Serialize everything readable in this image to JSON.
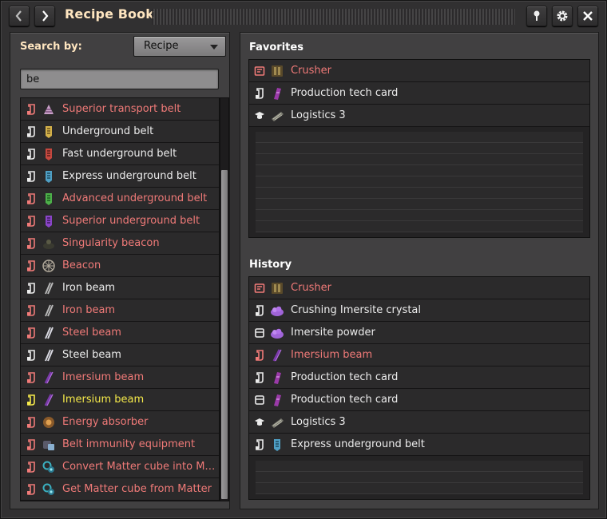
{
  "window": {
    "title": "Recipe Book"
  },
  "colors": {
    "title": "#ffe6c0",
    "red": "#f07a78",
    "white": "#ececec",
    "yellow": "#f5e94a",
    "panel": "#414041",
    "list_bg": "#242324"
  },
  "titlebar": {
    "back_icon": "chevron-left-icon",
    "forward_icon": "chevron-right-icon",
    "pin_icon": "pin-icon",
    "settings_icon": "gear-icon",
    "close_icon": "close-icon"
  },
  "search": {
    "label": "Search by:",
    "mode": "Recipe",
    "query": "be"
  },
  "results": [
    {
      "label": "Superior transport belt",
      "color": "red",
      "type": "recipe",
      "icon": "belt-superior"
    },
    {
      "label": "Underground belt",
      "color": "white",
      "type": "recipe",
      "icon": "underground-yellow"
    },
    {
      "label": "Fast underground belt",
      "color": "white",
      "type": "recipe",
      "icon": "underground-red"
    },
    {
      "label": "Express underground belt",
      "color": "white",
      "type": "recipe",
      "icon": "underground-blue"
    },
    {
      "label": "Advanced underground belt",
      "color": "red",
      "type": "recipe",
      "icon": "underground-green"
    },
    {
      "label": "Superior underground belt",
      "color": "red",
      "type": "recipe",
      "icon": "underground-purple"
    },
    {
      "label": "Singularity beacon",
      "color": "red",
      "type": "recipe",
      "icon": "beacon-dark"
    },
    {
      "label": "Beacon",
      "color": "red",
      "type": "recipe",
      "icon": "beacon"
    },
    {
      "label": "Iron beam",
      "color": "white",
      "type": "recipe",
      "icon": "beam-iron"
    },
    {
      "label": "Iron beam",
      "color": "red",
      "type": "recipe",
      "icon": "beam-iron"
    },
    {
      "label": "Steel beam",
      "color": "red",
      "type": "recipe",
      "icon": "beam-steel"
    },
    {
      "label": "Steel beam",
      "color": "white",
      "type": "recipe",
      "icon": "beam-steel"
    },
    {
      "label": "Imersium beam",
      "color": "red",
      "type": "recipe",
      "icon": "beam-imersium"
    },
    {
      "label": "Imersium beam",
      "color": "yellow",
      "type": "recipe",
      "icon": "beam-imersium"
    },
    {
      "label": "Energy absorber",
      "color": "red",
      "type": "recipe",
      "icon": "energy-absorber"
    },
    {
      "label": "Belt immunity equipment",
      "color": "red",
      "type": "recipe",
      "icon": "belt-immunity"
    },
    {
      "label": "Convert Matter cube into Ma...",
      "color": "red",
      "type": "recipe",
      "icon": "matter-cube"
    },
    {
      "label": "Get Matter cube from Matter",
      "color": "red",
      "type": "recipe",
      "icon": "matter-cube"
    }
  ],
  "favorites": {
    "title": "Favorites",
    "items": [
      {
        "label": "Crusher",
        "color": "red",
        "type": "machine",
        "icon": "crusher"
      },
      {
        "label": "Production tech card",
        "color": "white",
        "type": "recipe",
        "icon": "tech-card"
      },
      {
        "label": "Logistics 3",
        "color": "white",
        "type": "technology",
        "icon": "logistics"
      }
    ]
  },
  "history": {
    "title": "History",
    "items": [
      {
        "label": "Crusher",
        "color": "red",
        "type": "machine",
        "icon": "crusher"
      },
      {
        "label": "Crushing Imersite crystal",
        "color": "white",
        "type": "recipe",
        "icon": "imersite"
      },
      {
        "label": "Imersite powder",
        "color": "white",
        "type": "item",
        "icon": "imersite"
      },
      {
        "label": "Imersium beam",
        "color": "red",
        "type": "recipe",
        "icon": "beam-imersium"
      },
      {
        "label": "Production tech card",
        "color": "white",
        "type": "recipe",
        "icon": "tech-card"
      },
      {
        "label": "Production tech card",
        "color": "white",
        "type": "item",
        "icon": "tech-card"
      },
      {
        "label": "Logistics 3",
        "color": "white",
        "type": "technology",
        "icon": "logistics"
      },
      {
        "label": "Express underground belt",
        "color": "white",
        "type": "recipe",
        "icon": "underground-blue"
      }
    ]
  }
}
